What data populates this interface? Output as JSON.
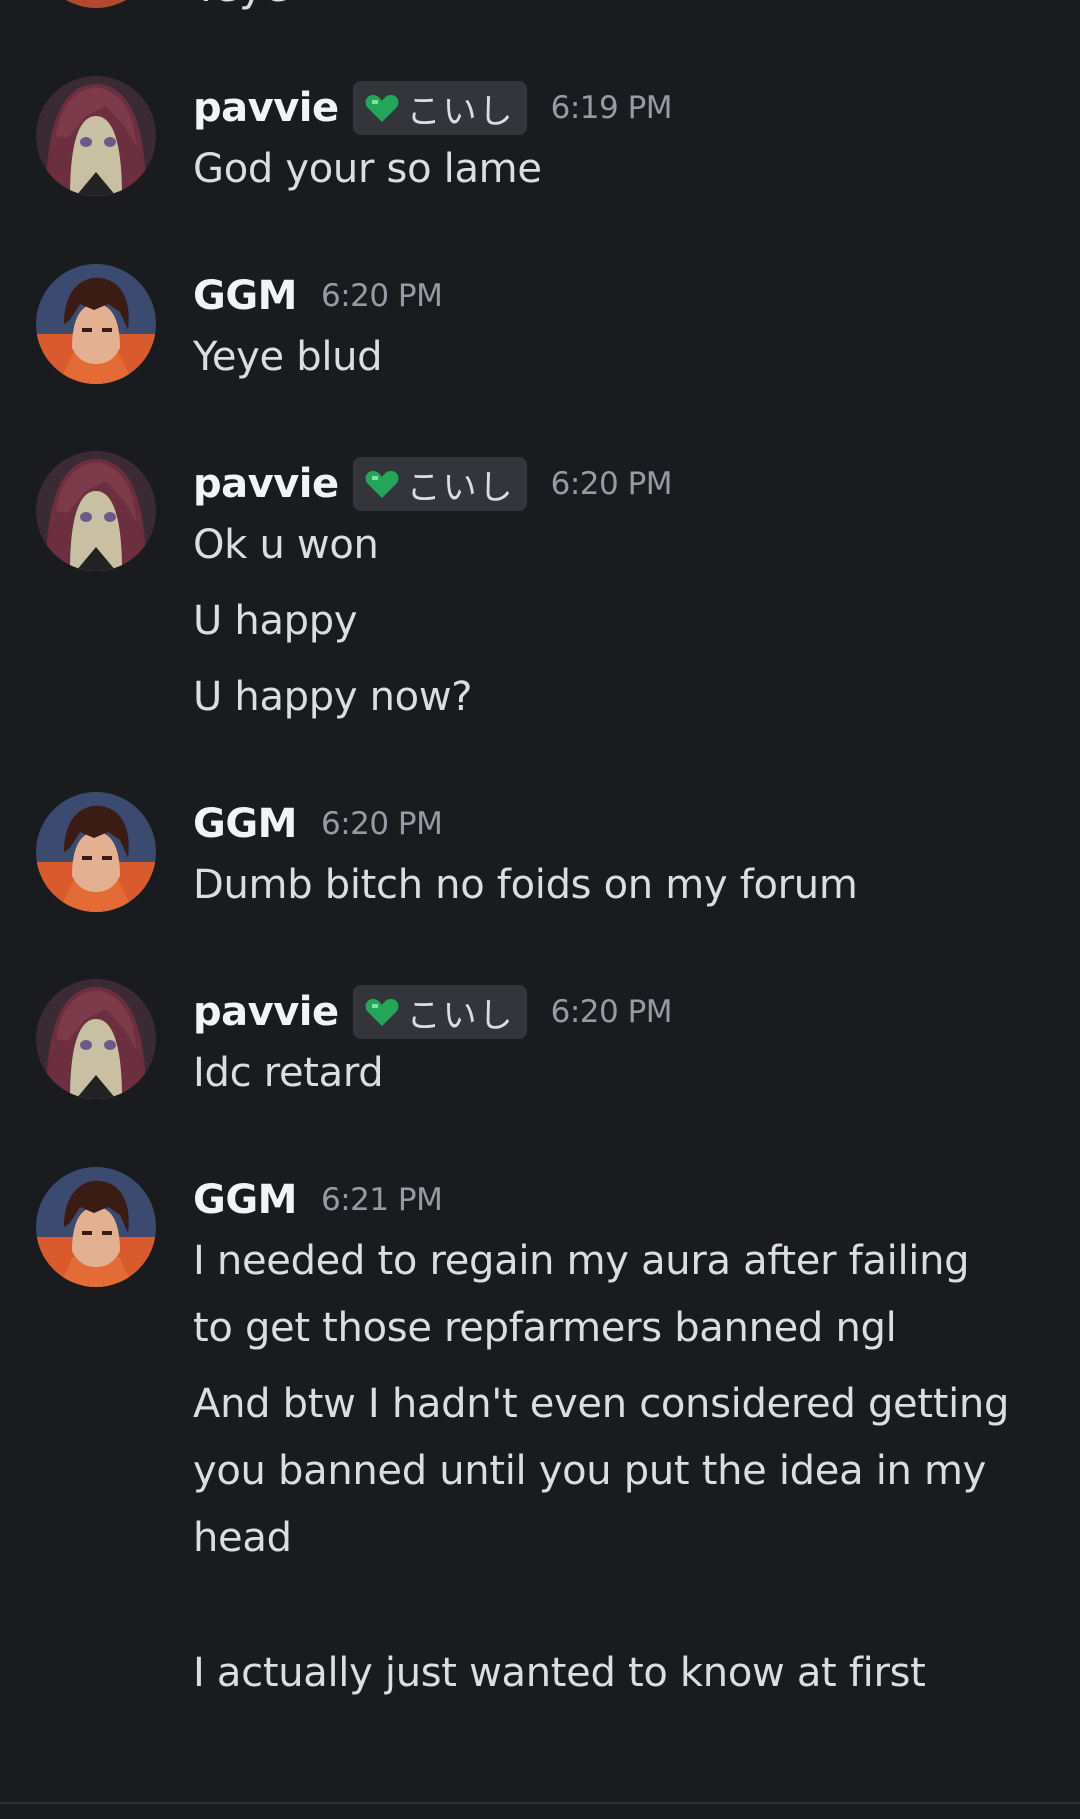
{
  "partial_top_text": "Yeye",
  "messages": [
    {
      "author": "pavvie",
      "tag": "こいし",
      "time": "6:19 PM",
      "lines": [
        "God your so lame"
      ]
    },
    {
      "author": "GGM",
      "time": "6:20 PM",
      "lines": [
        "Yeye blud"
      ]
    },
    {
      "author": "pavvie",
      "tag": "こいし",
      "time": "6:20 PM",
      "lines": [
        "Ok u won",
        "U happy",
        "U happy now?"
      ]
    },
    {
      "author": "GGM",
      "time": "6:20 PM",
      "lines": [
        "Dumb bitch no foids on my forum"
      ]
    },
    {
      "author": "pavvie",
      "tag": "こいし",
      "time": "6:20 PM",
      "lines": [
        "Idc retard"
      ]
    },
    {
      "author": "GGM",
      "time": "6:21 PM",
      "lines": [
        "I needed to regain my aura after failing",
        "to get those repfarmers banned ngl",
        "And btw I hadn't even considered getting",
        "you banned until you put the idea in my",
        "head",
        "I actually just wanted to know at first"
      ]
    }
  ],
  "colors": {
    "background": "#1a1b1f",
    "username": "#f2f3f5",
    "message_text": "#dbdee1",
    "timestamp": "#949ba4",
    "tag_background": "#34353b",
    "heart": "#23a55a"
  },
  "icons": {
    "tag_icon": "green-heart-icon"
  }
}
